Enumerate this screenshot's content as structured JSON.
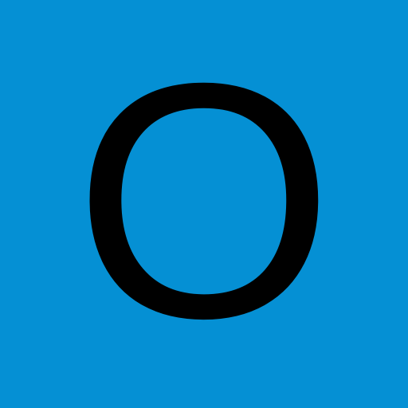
{
  "tile": {
    "letter": "O",
    "background_color": "#0590D4",
    "letter_color": "#000000"
  }
}
